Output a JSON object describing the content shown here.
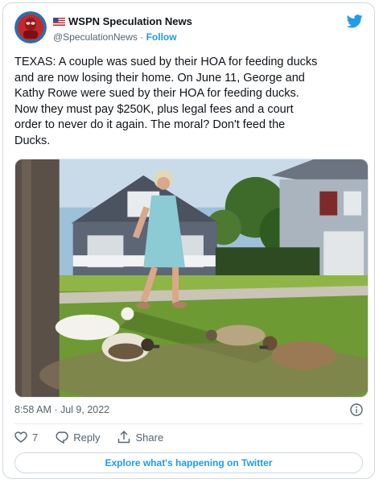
{
  "author": {
    "name": "WSPN Speculation News",
    "handle": "@SpeculationNews",
    "separator": "·",
    "follow_label": "Follow"
  },
  "tweet": {
    "text": "TEXAS: A couple was sued by their HOA for feeding ducks\nand are now losing their home. On June 11, George and\nKathy Rowe were sued by their HOA for feeding ducks.\nNow they must pay $250K, plus legal fees and a court\norder to never do it again. The moral? Don't feed the\nDucks.",
    "timestamp": "8:58 AM · Jul 9, 2022"
  },
  "actions": {
    "like_count": "7",
    "reply_label": "Reply",
    "share_label": "Share"
  },
  "explore_label": "Explore what's happening on Twitter",
  "colors": {
    "accent": "#1d9bf0",
    "text": "#0f1419",
    "secondary": "#536471",
    "border": "#cfd9de"
  },
  "icons": [
    "twitter-bird-icon",
    "us-flag-icon",
    "info-icon",
    "heart-icon",
    "reply-icon",
    "share-icon"
  ]
}
